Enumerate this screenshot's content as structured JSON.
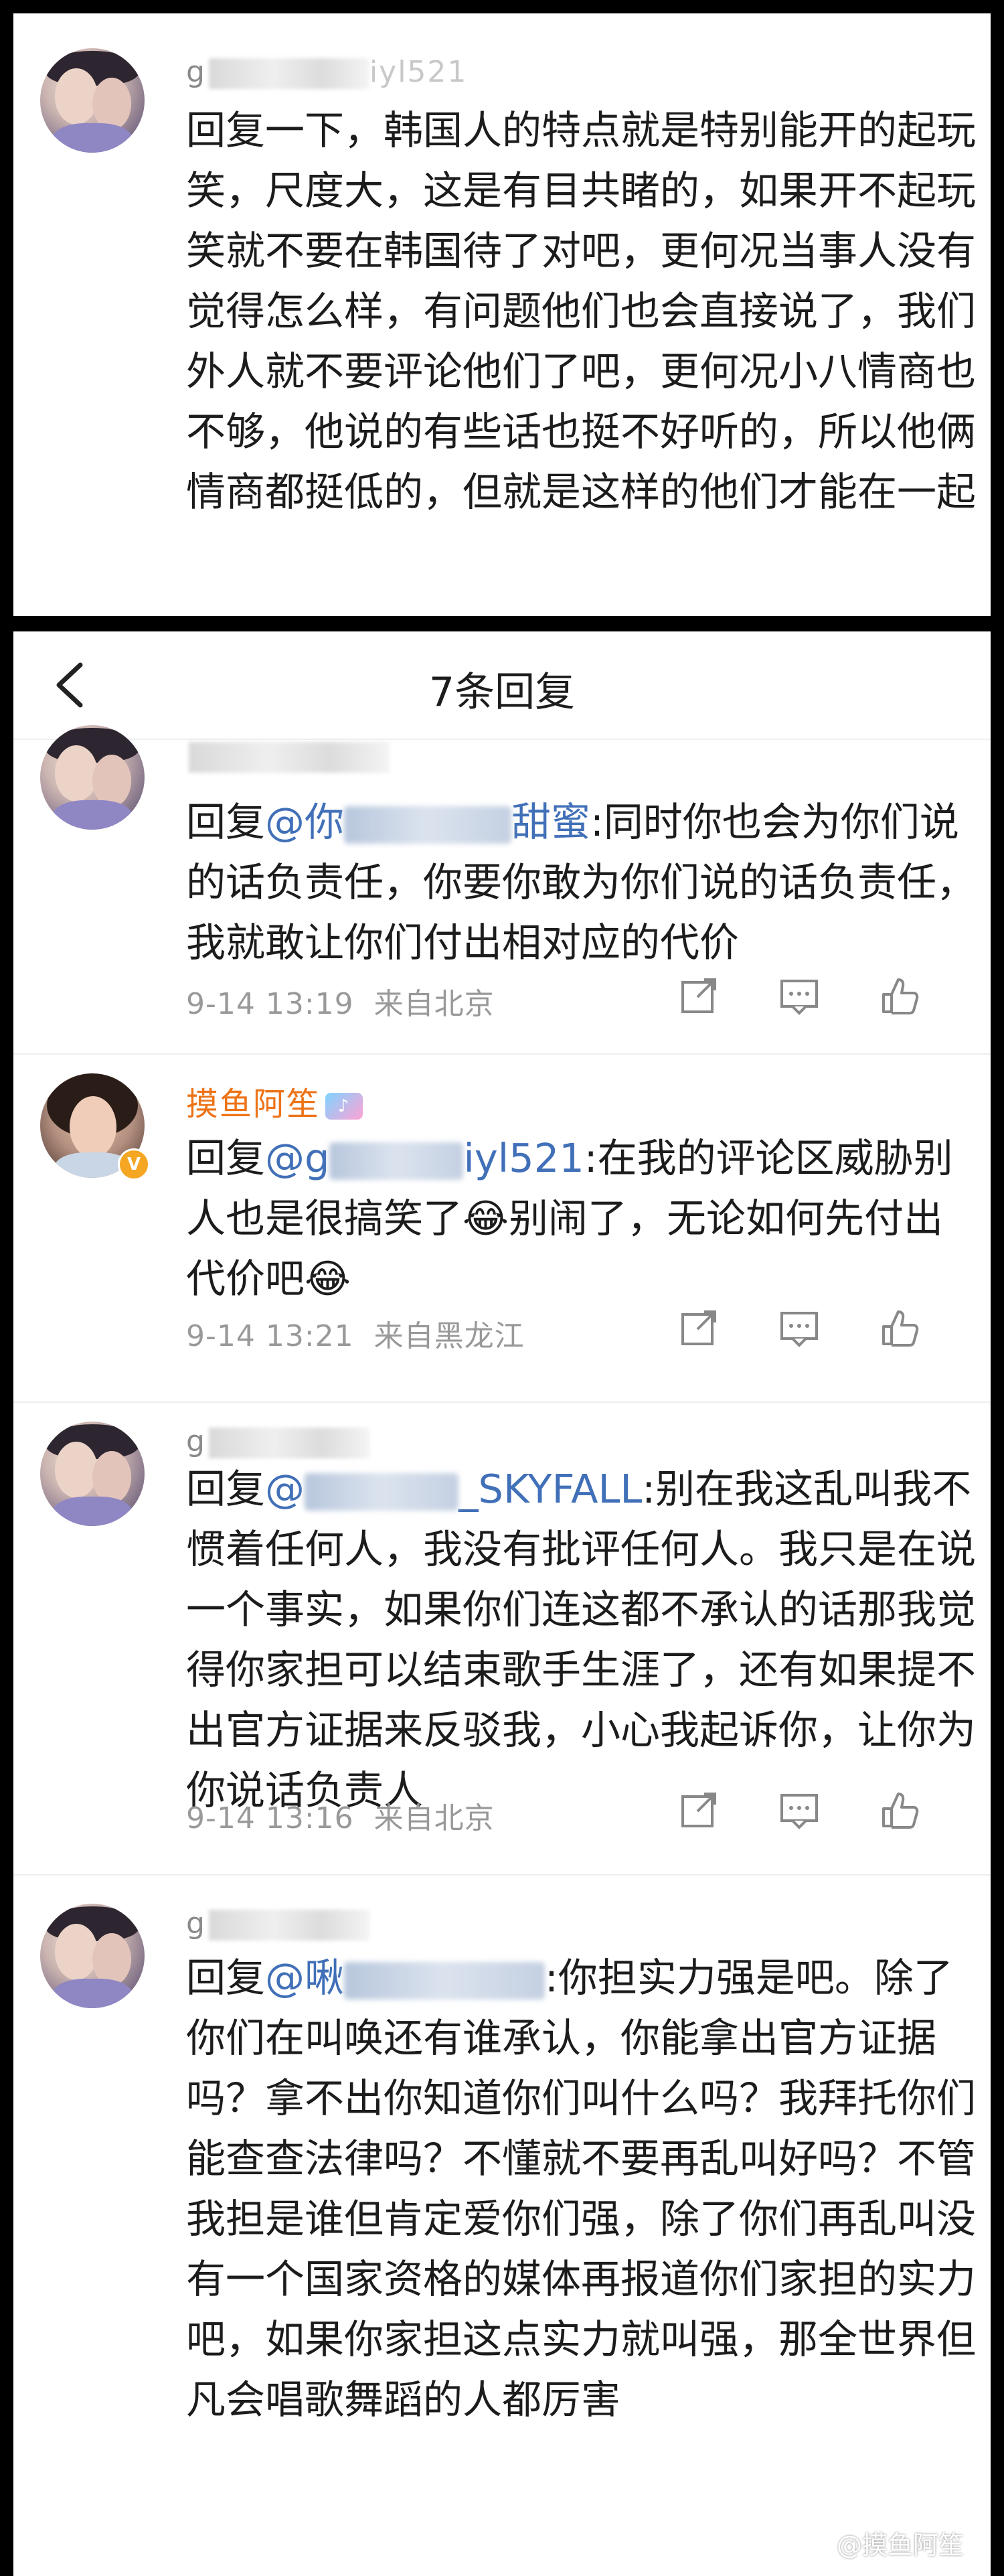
{
  "top_comment": {
    "username_prefix": "g",
    "username_suffix": "iyl521",
    "text": "回复一下，韩国人的特点就是特别能开的起玩笑，尺度大，这是有目共睹的，如果开不起玩笑就不要在韩国待了对吧，更何况当事人没有觉得怎么样，有问题他们也会直接说了，我们外人就不要评论他们了吧，更何况小八情商也不够，他说的有些话也挺不好听的，所以他俩情商都挺低的，但就是这样的他们才能在一起"
  },
  "reply_page": {
    "title": "7条回复",
    "back_icon": "chevron-left-icon"
  },
  "replies": [
    {
      "username": "",
      "reply_prefix": "回复",
      "mention_visible": "@你",
      "mention_tail": "甜蜜",
      "text": ":同时你也会为你们说的话负责任，你要你敢为你们说的话负责任，我就敢让你们付出相对应的代价",
      "time": "9-14 13:19",
      "location": "来自北京"
    },
    {
      "username": "摸鱼阿笙",
      "reply_prefix": "回复",
      "mention_visible": "@g",
      "mention_tail": "iyl521",
      "text": ":在我的评论区威胁别人也是很搞笑了😂别闹了，无论如何先付出代价吧😂",
      "time": "9-14 13:21",
      "location": "来自黑龙江"
    },
    {
      "username": "g",
      "reply_prefix": "回复",
      "mention_visible": "@",
      "mention_tail": "_SKYFALL",
      "text": ":别在我这乱叫我不惯着任何人，我没有批评任何人。我只是在说一个事实，如果你们连这都不承认的话那我觉得你家担可以结束歌手生涯了，还有如果提不出官方证据来反驳我，小心我起诉你，让你为你说话负责人",
      "time": "9-14 13:16",
      "location": "来自北京"
    },
    {
      "username": "g",
      "reply_prefix": "回复",
      "mention_visible": "@啾",
      "mention_tail": "",
      "text": ":你担实力强是吧。除了你们在叫唤还有谁承认，你能拿出官方证据吗？拿不出你知道你们叫什么吗？我拜托你们能查查法律吗？不懂就不要再乱叫好吗？不管我担是谁但肯定爱你们强，除了你们再乱叫没有一个国家资格的媒体再报道你们家担的实力吧，如果你家担这点实力就叫强，那全世界但凡会唱歌舞蹈的人都厉害",
      "time": "",
      "location": ""
    }
  ],
  "icons": [
    "share-icon",
    "comment-icon",
    "like-icon"
  ],
  "watermark": "@摸鱼阿笙"
}
